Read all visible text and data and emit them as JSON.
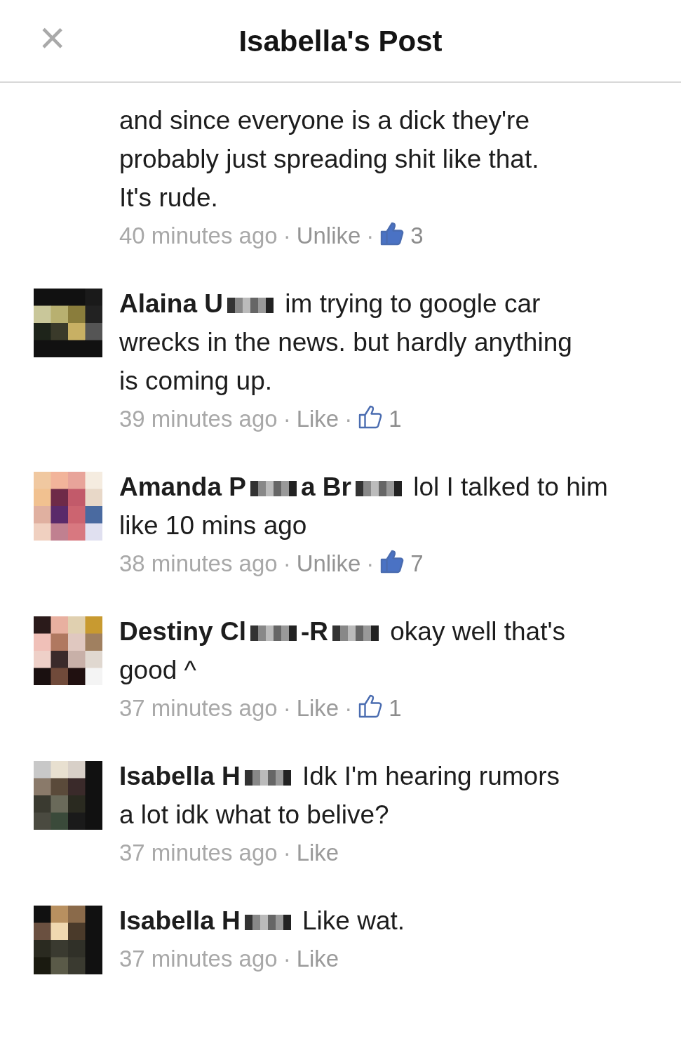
{
  "header": {
    "title": "Isabella's Post",
    "close": "×"
  },
  "comments": [
    {
      "lines": [
        "and since everyone is a dick they're",
        "probably just spreading shit like that.",
        "It's rude."
      ],
      "time": "40 minutes ago",
      "separators": [
        "·",
        "·"
      ],
      "action": "Unlike",
      "liked": true,
      "likes": "3"
    },
    {
      "author_parts": [
        {
          "kind": "text",
          "text": "Alaina U"
        },
        {
          "kind": "censor"
        }
      ],
      "lines": [
        "im trying to google car",
        "wrecks in the news. but hardly anything",
        "is coming up."
      ],
      "time": "39 minutes ago",
      "separators": [
        "·",
        "·"
      ],
      "action": "Like",
      "liked": false,
      "likes": "1"
    },
    {
      "author_parts": [
        {
          "kind": "text",
          "text": "Amanda P"
        },
        {
          "kind": "censor"
        },
        {
          "kind": "text",
          "text": "a Br"
        },
        {
          "kind": "censor"
        }
      ],
      "lines": [
        "lol I talked to him",
        "like 10 mins ago"
      ],
      "time": "38 minutes ago",
      "separators": [
        "·",
        "·"
      ],
      "action": "Unlike",
      "liked": true,
      "likes": "7"
    },
    {
      "author_parts": [
        {
          "kind": "text",
          "text": "Destiny Cl"
        },
        {
          "kind": "censor"
        },
        {
          "kind": "text",
          "text": "-R"
        },
        {
          "kind": "censor"
        }
      ],
      "lines": [
        "okay well that's",
        "good ^"
      ],
      "time": "37 minutes ago",
      "separators": [
        "·",
        "·"
      ],
      "action": "Like",
      "liked": false,
      "likes": "1"
    },
    {
      "author_parts": [
        {
          "kind": "text",
          "text": "Isabella H"
        },
        {
          "kind": "censor"
        }
      ],
      "lines": [
        "Idk I'm hearing rumors",
        "a lot idk what to belive?"
      ],
      "time": "37 minutes ago",
      "separators": [
        "·"
      ],
      "action": "Like",
      "liked": false
    },
    {
      "author_parts": [
        {
          "kind": "text",
          "text": "Isabella H"
        },
        {
          "kind": "censor"
        }
      ],
      "lines": [
        "Like wat."
      ],
      "time": "37 minutes ago",
      "separators": [
        "·"
      ],
      "action": "Like",
      "liked": false
    }
  ]
}
